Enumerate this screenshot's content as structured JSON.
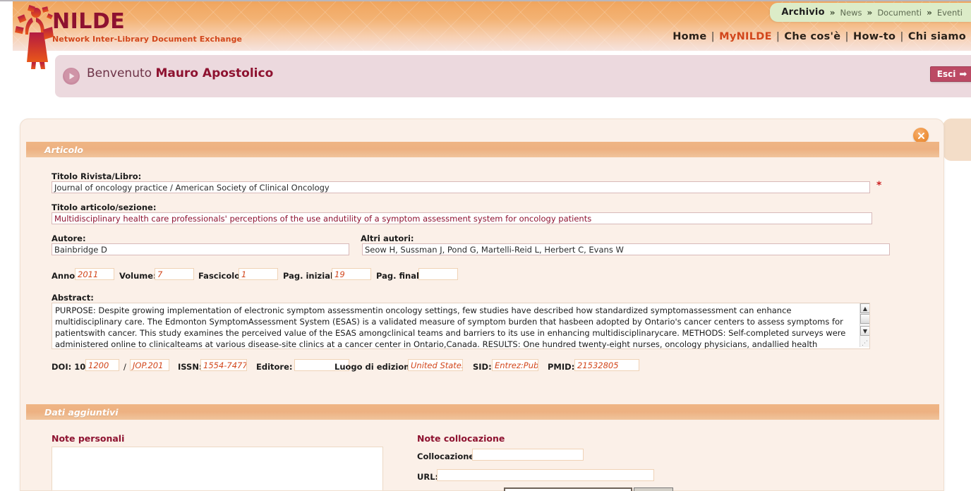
{
  "brand": {
    "name": "NILDE",
    "tagline": "Network Inter-Library Document Exchange"
  },
  "archivio_nav": {
    "main": "Archivio",
    "separator": "»",
    "items": [
      "News",
      "Documenti",
      "Eventi"
    ]
  },
  "main_nav": {
    "separator": "|",
    "items": [
      {
        "label": "Home",
        "active": false
      },
      {
        "label": "MyNILDE",
        "active": true
      },
      {
        "label": "Che cos'è",
        "active": false
      },
      {
        "label": "How-to",
        "active": false
      },
      {
        "label": "Chi siamo",
        "active": false
      }
    ]
  },
  "welcome": {
    "greeting": "Benvenuto",
    "user": "Mauro Apostolico",
    "logout_label": "Esci",
    "logout_arrow": "➡"
  },
  "sections": {
    "articolo": "Articolo",
    "dati_aggiuntivi": "Dati aggiuntivi"
  },
  "form": {
    "titolo_rivista_label": "Titolo Rivista/Libro:",
    "titolo_rivista_value": "Journal of oncology practice / American Society of Clinical Oncology",
    "required_marker": "*",
    "titolo_articolo_label": "Titolo articolo/sezione:",
    "titolo_articolo_value": "Multidisciplinary health care professionals' perceptions of the use andutility of a symptom assessment system for oncology patients",
    "autore_label": "Autore:",
    "autore_value": "Bainbridge D",
    "altri_autori_label": "Altri autori:",
    "altri_autori_value": "Seow H, Sussman J, Pond G, Martelli-Reid L, Herbert C, Evans W",
    "anno_label": "Anno:",
    "anno_value": "2011",
    "volume_label": "Volume:",
    "volume_value": "7",
    "fascicolo_label": "Fascicolo:",
    "fascicolo_value": "1",
    "pag_iniziale_label": "Pag. iniziale:",
    "pag_iniziale_value": "19",
    "pag_finale_label": "Pag. finale:",
    "pag_finale_value": "",
    "abstract_label": "Abstract:",
    "abstract_value": "PURPOSE: Despite growing implementation of electronic symptom assessmentin oncology settings, few studies have described how standardized symptomassessment can enhance multidisciplinary care. The Edmonton SymptomAssessment System (ESAS) is a validated measure of symptom burden that hasbeen adopted by Ontario's cancer centers to assess symptoms for patientswith cancer. This study examines the perceived value of the ESAS amongclinical teams and barriers to its use in enhancing multidisciplinarycare. METHODS: Self-completed surveys were administered online to clinicalteams at various disease-site clinics at a cancer center in Ontario,Canada. RESULTS: One hundred twenty-eight nurses, oncology physicians, andallied health professions completed",
    "doi_label": "DOI: 10.",
    "doi_prefix_value": "1200",
    "doi_separator": "/",
    "doi_suffix_value": "JOP.201",
    "issn_label": "ISSN:",
    "issn_value": "1554-7477",
    "editore_label": "Editore:",
    "editore_value": "",
    "luogo_label": "Luogo di edizione:",
    "luogo_value": "United States",
    "sid_label": "SID:",
    "sid_value": "Entrez:Pubk",
    "pmid_label": "PMID:",
    "pmid_value": "21532805"
  },
  "extra": {
    "note_personali_label": "Note personali",
    "note_personali_value": "",
    "note_collocazione_label": "Note collocazione",
    "collocazione_label": "Collocazione:",
    "collocazione_value": "",
    "url_label": "URL:",
    "url_value": ""
  },
  "icons": {
    "close": "close-icon",
    "play": "play-circle-icon",
    "arrow_up": "▲",
    "arrow_down": "▼",
    "resize_grip": "⋰"
  },
  "colors": {
    "brand_maroon": "#8e1230",
    "accent_orange": "#d2461b",
    "header_orange": "#f0a55e",
    "panel_bg": "#fbf0e8",
    "welcome_bg": "#ecd9de",
    "archivio_green": "#dcecc8",
    "esci_red": "#bc4a64"
  }
}
